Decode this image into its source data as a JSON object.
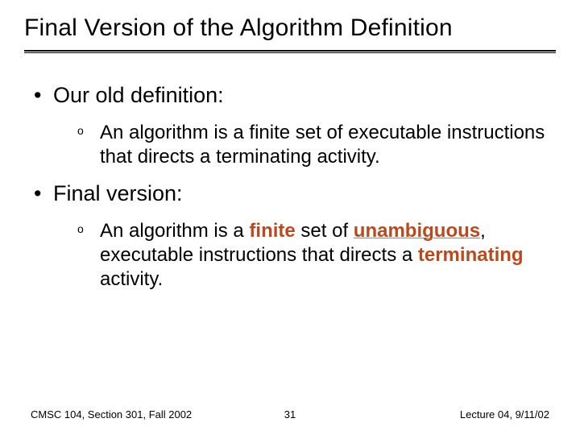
{
  "title": "Final Version of the Algorithm Definition",
  "bullets": [
    {
      "heading": "Our old definition:",
      "sub_pre": "An algorithm is a finite set of executable instructions that directs a terminating activity."
    },
    {
      "heading": "Final version:",
      "sub": {
        "t1": "An algorithm is a ",
        "k_finite": "finite",
        "t2": " set of ",
        "k_unambiguous": "unambiguous",
        "t3": ", executable instructions that directs a ",
        "k_terminating": "terminating",
        "t4": " activity."
      }
    }
  ],
  "footer": {
    "left": "CMSC 104, Section 301, Fall 2002",
    "page": "31",
    "right": "Lecture 04, 9/11/02"
  }
}
